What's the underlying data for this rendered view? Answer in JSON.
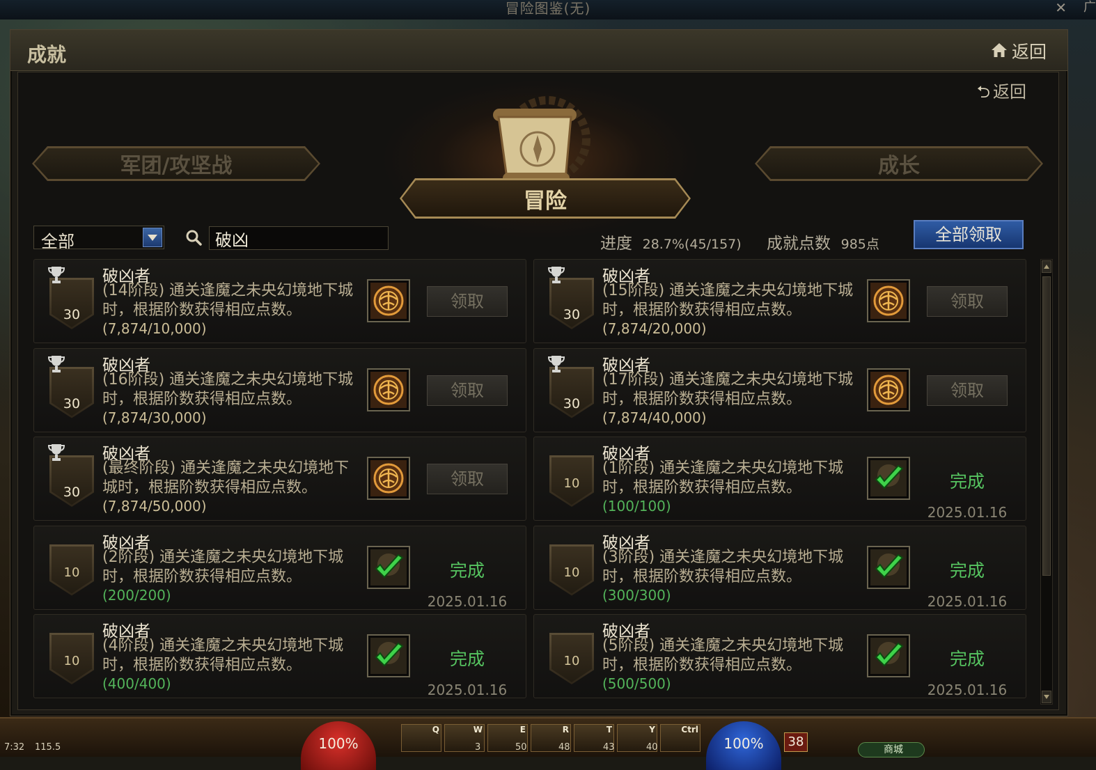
{
  "app": {
    "title": "冒险图鉴(无)",
    "close_glyph": "✕",
    "extra_glyph": "广"
  },
  "header": {
    "title": "成就",
    "back_label": "返回"
  },
  "sub_back_label": "返回",
  "tabs": {
    "left": "军团/攻坚战",
    "center": "冒险",
    "right": "成长"
  },
  "filter": {
    "selected": "全部"
  },
  "search": {
    "value": "破凶"
  },
  "stats": {
    "progress_label": "进度",
    "progress_value": "28.7%(45/157)",
    "points_label": "成就点数",
    "points_value": "985点"
  },
  "claim_all_label": "全部领取",
  "achievements": [
    {
      "name": "破凶者",
      "desc": "(14阶段) 通关逢魔之未央幻境地下城时，根据阶数获得相应点数。",
      "progress": "(7,874/10,000)",
      "points": "30",
      "state": "claim",
      "action": "领取"
    },
    {
      "name": "破凶者",
      "desc": "(15阶段) 通关逢魔之未央幻境地下城时，根据阶数获得相应点数。",
      "progress": "(7,874/20,000)",
      "points": "30",
      "state": "claim",
      "action": "领取"
    },
    {
      "name": "破凶者",
      "desc": "(16阶段) 通关逢魔之未央幻境地下城时，根据阶数获得相应点数。",
      "progress": "(7,874/30,000)",
      "points": "30",
      "state": "claim",
      "action": "领取"
    },
    {
      "name": "破凶者",
      "desc": "(17阶段) 通关逢魔之未央幻境地下城时，根据阶数获得相应点数。",
      "progress": "(7,874/40,000)",
      "points": "30",
      "state": "claim",
      "action": "领取"
    },
    {
      "name": "破凶者",
      "desc": "(最终阶段) 通关逢魔之未央幻境地下城时，根据阶数获得相应点数。",
      "progress": "(7,874/50,000)",
      "points": "30",
      "state": "claim",
      "action": "领取"
    },
    {
      "name": "破凶者",
      "desc": "(1阶段) 通关逢魔之未央幻境地下城时，根据阶数获得相应点数。",
      "progress": "(100/100)",
      "points": "10",
      "state": "done",
      "action": "完成",
      "date": "2025.01.16"
    },
    {
      "name": "破凶者",
      "desc": "(2阶段) 通关逢魔之未央幻境地下城时，根据阶数获得相应点数。",
      "progress": "(200/200)",
      "points": "10",
      "state": "done",
      "action": "完成",
      "date": "2025.01.16"
    },
    {
      "name": "破凶者",
      "desc": "(3阶段) 通关逢魔之未央幻境地下城时，根据阶数获得相应点数。",
      "progress": "(300/300)",
      "points": "10",
      "state": "done",
      "action": "完成",
      "date": "2025.01.16"
    },
    {
      "name": "破凶者",
      "desc": "(4阶段) 通关逢魔之未央幻境地下城时，根据阶数获得相应点数。",
      "progress": "(400/400)",
      "points": "10",
      "state": "done",
      "action": "完成",
      "date": "2025.01.16"
    },
    {
      "name": "破凶者",
      "desc": "(5阶段) 通关逢魔之未央幻境地下城时，根据阶数获得相应点数。",
      "progress": "(500/500)",
      "points": "10",
      "state": "done",
      "action": "完成",
      "date": "2025.01.16"
    }
  ],
  "hud": {
    "hp": "100%",
    "mp": "100%",
    "level": "38",
    "keys": [
      "Q",
      "W",
      "E",
      "R",
      "T",
      "Y",
      "Ctrl"
    ],
    "slot_counts": [
      "3",
      "50",
      "48",
      "43",
      "40"
    ],
    "shop": "商城",
    "gold": "115.5",
    "time": "7:32"
  },
  "colors": {
    "accent_blue": "#2f5ca4",
    "done_green": "#56c460",
    "progress_green": "#53b45a"
  }
}
